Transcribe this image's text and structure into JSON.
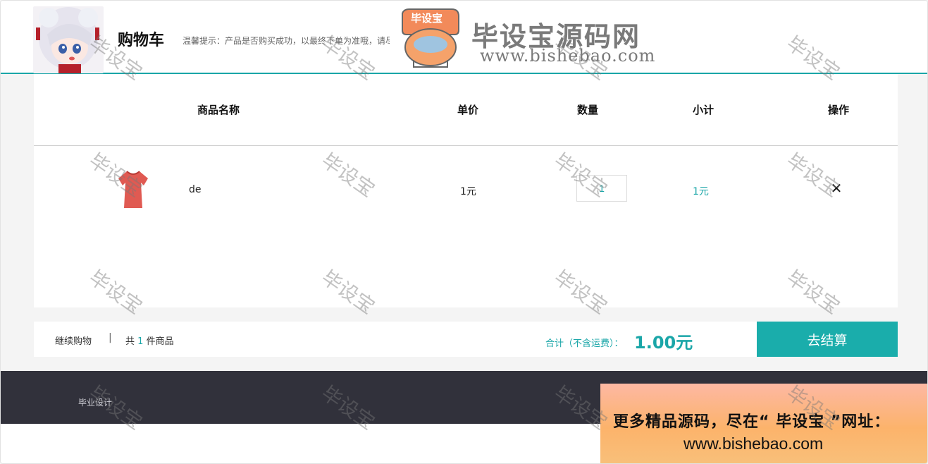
{
  "header": {
    "title": "购物车",
    "tip": "温馨提示：产品是否购买成功，以最终下单为准哦，请尽快结算"
  },
  "brand": {
    "badge_text": "毕设宝",
    "name": "毕设宝源码网",
    "url": "www.bishebao.com"
  },
  "table": {
    "columns": [
      "商品名称",
      "单价",
      "数量",
      "小计",
      "操作"
    ],
    "rows": [
      {
        "name": "de",
        "price": "1元",
        "quantity": "1",
        "subtotal": "1元",
        "remove_icon": "close-icon",
        "remove_glyph": "✕"
      }
    ]
  },
  "summary": {
    "continue_label": "继续购物",
    "separator": "|",
    "count_prefix": "共",
    "count": "1",
    "count_suffix": "件商品",
    "total_label": "合计（不含运费）：",
    "total_value": "1.00元",
    "checkout_label": "去结算"
  },
  "footer": {
    "link": "毕业设计"
  },
  "promo": {
    "line1": "更多精品源码，尽在“ 毕设宝 ”网址：",
    "line2": "www.bishebao.com"
  },
  "watermark": "毕设宝",
  "colors": {
    "accent": "#1aa6a8",
    "footer": "#31313b"
  }
}
